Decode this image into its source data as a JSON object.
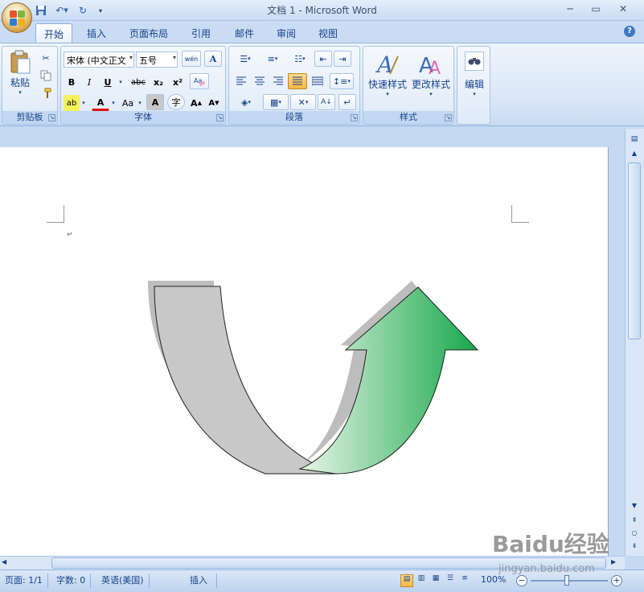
{
  "window": {
    "title": "文档 1 - Microsoft Word",
    "minimize_icon": "minimize-icon",
    "maximize_icon": "maximize-icon",
    "close_icon": "close-icon"
  },
  "quick_access": [
    "save-icon",
    "undo-icon",
    "redo-icon",
    "customize-icon"
  ],
  "tabs": [
    {
      "label": "开始",
      "active": true
    },
    {
      "label": "插入"
    },
    {
      "label": "页面布局"
    },
    {
      "label": "引用"
    },
    {
      "label": "邮件"
    },
    {
      "label": "审阅"
    },
    {
      "label": "视图"
    }
  ],
  "ribbon": {
    "clipboard": {
      "label": "剪贴板",
      "paste_label": "粘贴"
    },
    "font": {
      "label": "字体",
      "font_name": "宋体 (中文正文",
      "font_size": "五号",
      "bold": "B",
      "italic": "I",
      "underline": "U",
      "strikethrough": "abc",
      "subscript": "x₂",
      "superscript": "x²",
      "change_case": "Aa",
      "font_color_letter": "A",
      "highlight_letter": "ab",
      "char_shading": "A",
      "grow": "A",
      "shrink": "A",
      "phonetic": "wén",
      "enclose": "字"
    },
    "paragraph": {
      "label": "段落"
    },
    "styles": {
      "label": "样式",
      "quick_styles": "快速样式",
      "change_styles": "更改样式"
    },
    "editing": {
      "label": "编辑"
    }
  },
  "document": {
    "paragraph_mark": "↵"
  },
  "statusbar": {
    "page": "页面: 1/1",
    "words": "字数: 0",
    "language": "英语(美国)",
    "mode": "插入",
    "zoom": "100%"
  },
  "watermark": {
    "text": "Baidu经验",
    "url": "jingyan.baidu.com"
  },
  "colors": {
    "arrow_gray": "#c8c8c8",
    "arrow_green_light": "#d9efd9",
    "arrow_green_dark": "#1fa84a",
    "shadow": "#bdbdbd"
  }
}
